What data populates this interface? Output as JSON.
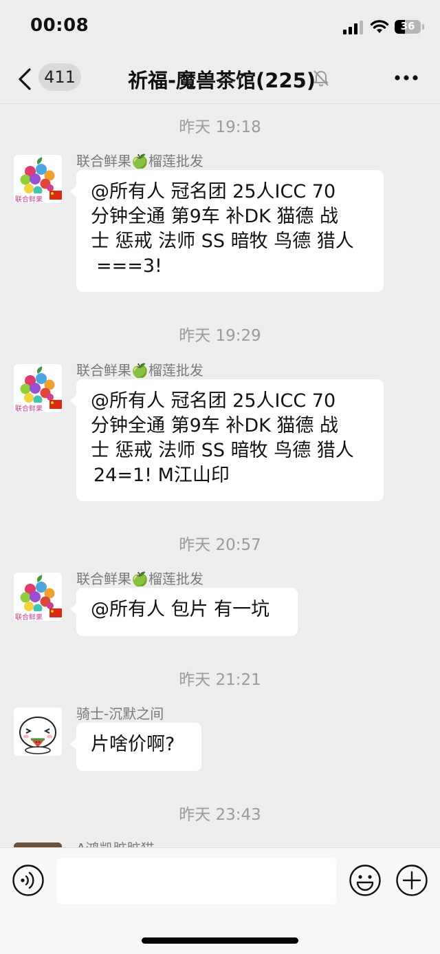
{
  "status_bar": {
    "time": "00:08",
    "battery": "36"
  },
  "nav": {
    "unread_count": "411",
    "title": "祈福-魔兽茶馆(225)"
  },
  "messages": [
    {
      "timestamp": "昨天 19:18",
      "sender": "联合鲜果🍏榴莲批发",
      "avatar_icon": "apple-fruit-logo-icon",
      "avatar_caption": "联合鲜果",
      "lines": [
        "@所有人 冠名团 25人ICC 70",
        "分钟全通 第9车 补DK 猫德 战",
        "士 惩戒 法师 SS 暗牧 鸟德 猎人",
        "  ===3!"
      ]
    },
    {
      "timestamp": "昨天 19:29",
      "sender": "联合鲜果🍏榴莲批发",
      "avatar_icon": "apple-fruit-logo-icon",
      "avatar_caption": "联合鲜果",
      "lines": [
        "@所有人 冠名团 25人ICC 70",
        "分钟全通 第9车 补DK 猫德 战",
        "士 惩戒 法师 SS 暗牧 鸟德 猎人",
        " 24=1!  M江山印"
      ]
    },
    {
      "timestamp": "昨天 20:57",
      "sender": "联合鲜果🍏榴莲批发",
      "avatar_icon": "apple-fruit-logo-icon",
      "avatar_caption": "联合鲜果",
      "lines": [
        "@所有人 包片 有一坑"
      ]
    },
    {
      "timestamp": "昨天 21:21",
      "sender": "骑士-沉默之间",
      "avatar_icon": "cartoon-face-icon",
      "lines": [
        "片啥价啊?"
      ]
    },
    {
      "timestamp": "昨天 23:43",
      "sender": "A鸿凯脏脏猫",
      "avatar_icon": "photo-avatar-icon",
      "lines": []
    }
  ],
  "input": {
    "placeholder": ""
  },
  "colors": {
    "background": "#ededed",
    "bubble": "#ffffff",
    "timestamp_text": "#9b9b9b",
    "sender_text": "#7a7a7a"
  }
}
